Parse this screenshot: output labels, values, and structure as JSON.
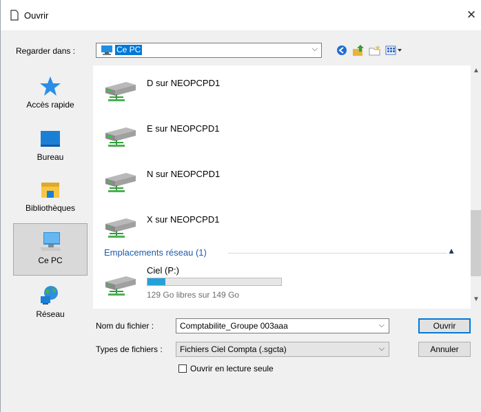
{
  "window": {
    "title": "Ouvrir",
    "close_glyph": "✕"
  },
  "lookin": {
    "label": "Regarder dans :",
    "value": "Ce PC"
  },
  "toolbar": {
    "icons": [
      "back-icon",
      "up-folder-icon",
      "new-folder-icon",
      "view-menu-icon"
    ]
  },
  "places": [
    {
      "label": "Accès rapide",
      "icon": "star-icon"
    },
    {
      "label": "Bureau",
      "icon": "desktop-icon"
    },
    {
      "label": "Bibliothèques",
      "icon": "libraries-icon"
    },
    {
      "label": "Ce PC",
      "icon": "computer-icon",
      "selected": true
    },
    {
      "label": "Réseau",
      "icon": "network-icon"
    }
  ],
  "drives": [
    {
      "label": "D sur NEOPCPD1"
    },
    {
      "label": "E sur NEOPCPD1"
    },
    {
      "label": "N sur NEOPCPD1"
    },
    {
      "label": "X sur NEOPCPD1"
    }
  ],
  "network_group": {
    "header": "Emplacements réseau (1)",
    "item": {
      "name": "Ciel (P:)",
      "free_text": "129 Go libres sur 149 Go",
      "used_fraction": 0.134
    }
  },
  "form": {
    "filename_label": "Nom du fichier :",
    "filename_value": "Comptabilite_Groupe 003aaa",
    "filetype_label": "Types de fichiers :",
    "filetype_value": "Fichiers Ciel Compta (.sgcta)",
    "readonly_label": "Ouvrir en lecture seule",
    "open_button": "Ouvrir",
    "cancel_button": "Annuler"
  },
  "colors": {
    "accent": "#0078d7",
    "progress": "#26a0da",
    "group_header": "#1e5aa8"
  }
}
